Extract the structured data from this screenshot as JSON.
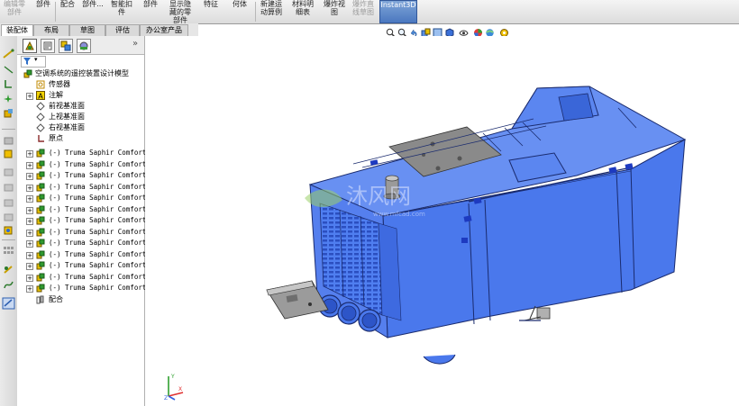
{
  "ribbon": {
    "buttons": [
      {
        "label": "编辑零\n部件",
        "dim": true
      },
      {
        "label": "部件",
        "dim": false
      },
      {
        "label": "配合",
        "dim": false
      },
      {
        "label": "部件...",
        "dim": false
      },
      {
        "label": "智能扣\n件",
        "dim": false
      },
      {
        "label": "部件",
        "dim": false
      },
      {
        "label": "显示隐\n藏的零\n部件",
        "dim": false
      },
      {
        "label": "特征",
        "dim": false
      },
      {
        "label": "何体",
        "dim": false
      },
      {
        "label": "新建运\n动算例",
        "dim": false
      },
      {
        "label": "材料明\n细表",
        "dim": false
      },
      {
        "label": "爆炸视\n图",
        "dim": false
      },
      {
        "label": "爆炸直\n线草图",
        "dim": true
      }
    ],
    "instant3d": "Instant3D"
  },
  "tabs": [
    {
      "label": "装配体",
      "active": true
    },
    {
      "label": "布局",
      "active": false
    },
    {
      "label": "草图",
      "active": false
    },
    {
      "label": "评估",
      "active": false
    },
    {
      "label": "办公室产品",
      "active": false
    }
  ],
  "tree": {
    "root": "空调系统的遥控装置设计模型",
    "sensors": "传感器",
    "annotations": "注解",
    "front_plane": "前视基准面",
    "top_plane": "上视基准面",
    "right_plane": "右视基准面",
    "origin": "原点",
    "components": [
      "(-) Truma Saphir Comfort",
      "(-) Truma Saphir Comfort",
      "(-) Truma Saphir Comfort",
      "(-) Truma Saphir Comfort",
      "(-) Truma Saphir Comfort",
      "(-) Truma Saphir Comfort",
      "(-) Truma Saphir Comfort",
      "(-) Truma Saphir Comfort",
      "(-) Truma Saphir Comfort",
      "(-) Truma Saphir Comfort",
      "(-) Truma Saphir Comfort",
      "(-) Truma Saphir Comfort",
      "(-) Truma Saphir Comfort"
    ],
    "mates": "配合"
  },
  "watermark": {
    "brand": "沐风网",
    "url": "www.mfcad.com"
  },
  "triad": {
    "x": "X",
    "y": "Y",
    "z": "Z"
  },
  "colors": {
    "model_blue": "#4f7ef0",
    "model_edge": "#1a2b6e",
    "panel_gray": "#8a8a8a",
    "highlight": "#3a6fd8"
  }
}
